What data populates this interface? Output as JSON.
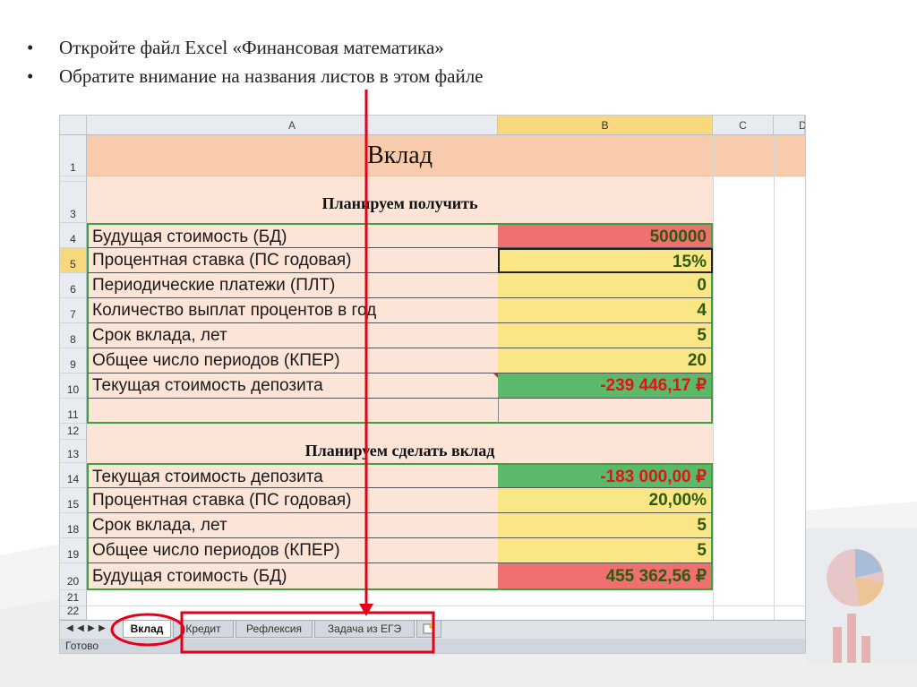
{
  "slide": {
    "bullets": [
      "Откройте файл Excel «Финансовая математика»",
      "Обратите внимание на названия листов в этом файле"
    ],
    "bullet_glyph": "•"
  },
  "sheet": {
    "columns": [
      "A",
      "B",
      "C",
      "D"
    ],
    "title": "Вклад",
    "section1_title": "Планируем получить",
    "section2_title": "Планируем сделать вклад",
    "rows": [
      {
        "num": "1",
        "label": "",
        "value": ""
      },
      {
        "num": "",
        "label": "",
        "value": ""
      },
      {
        "num": "3",
        "label": "",
        "value": ""
      },
      {
        "num": "4",
        "label": "Будущая стоимость (БД)",
        "value": "500000"
      },
      {
        "num": "5",
        "label": "Процентная ставка (ПС годовая)",
        "value": "15%"
      },
      {
        "num": "6",
        "label": "Периодические платежи (ПЛТ)",
        "value": "0"
      },
      {
        "num": "7",
        "label": "Количество выплат процентов в год",
        "value": "4"
      },
      {
        "num": "8",
        "label": "Срок вклада, лет",
        "value": "5"
      },
      {
        "num": "9",
        "label": "Общее число периодов (КПЕР)",
        "value": "20"
      },
      {
        "num": "10",
        "label": "Текущая стоимость депозита",
        "value": "-239 446,17 ₽"
      },
      {
        "num": "11",
        "label": "",
        "value": ""
      },
      {
        "num": "12",
        "label": "",
        "value": ""
      },
      {
        "num": "13",
        "label": "",
        "value": ""
      },
      {
        "num": "14",
        "label": "Текущая стоимость депозита",
        "value": "-183 000,00 ₽"
      },
      {
        "num": "15",
        "label": "Процентная ставка (ПС годовая)",
        "value": "20,00%"
      },
      {
        "num": "18",
        "label": "Срок вклада, лет",
        "value": "5"
      },
      {
        "num": "19",
        "label": "Общее число периодов (КПЕР)",
        "value": "5"
      },
      {
        "num": "20",
        "label": "Будущая стоимость (БД)",
        "value": "455 362,56 ₽"
      },
      {
        "num": "21",
        "label": "",
        "value": ""
      },
      {
        "num": "22",
        "label": "",
        "value": ""
      }
    ],
    "tabs": [
      "Вклад",
      "Кредит",
      "Рефлексия",
      "Задача из ЕГЭ"
    ],
    "new_sheet_icon": "new-sheet-icon",
    "nav_glyphs": [
      "◀",
      "◀",
      "▶",
      "▶"
    ],
    "status": "Готово"
  },
  "colors": {
    "cell_peach": "#fce4d6",
    "title_peach": "#f8cbad",
    "value_yellow": "#fbe685",
    "value_red": "#f07070",
    "value_green": "#5cb96a",
    "text_dark_green": "#2f5a10",
    "text_red": "#e01515",
    "annotation_red": "#e2001a",
    "grid_green": "#3aa33f"
  }
}
